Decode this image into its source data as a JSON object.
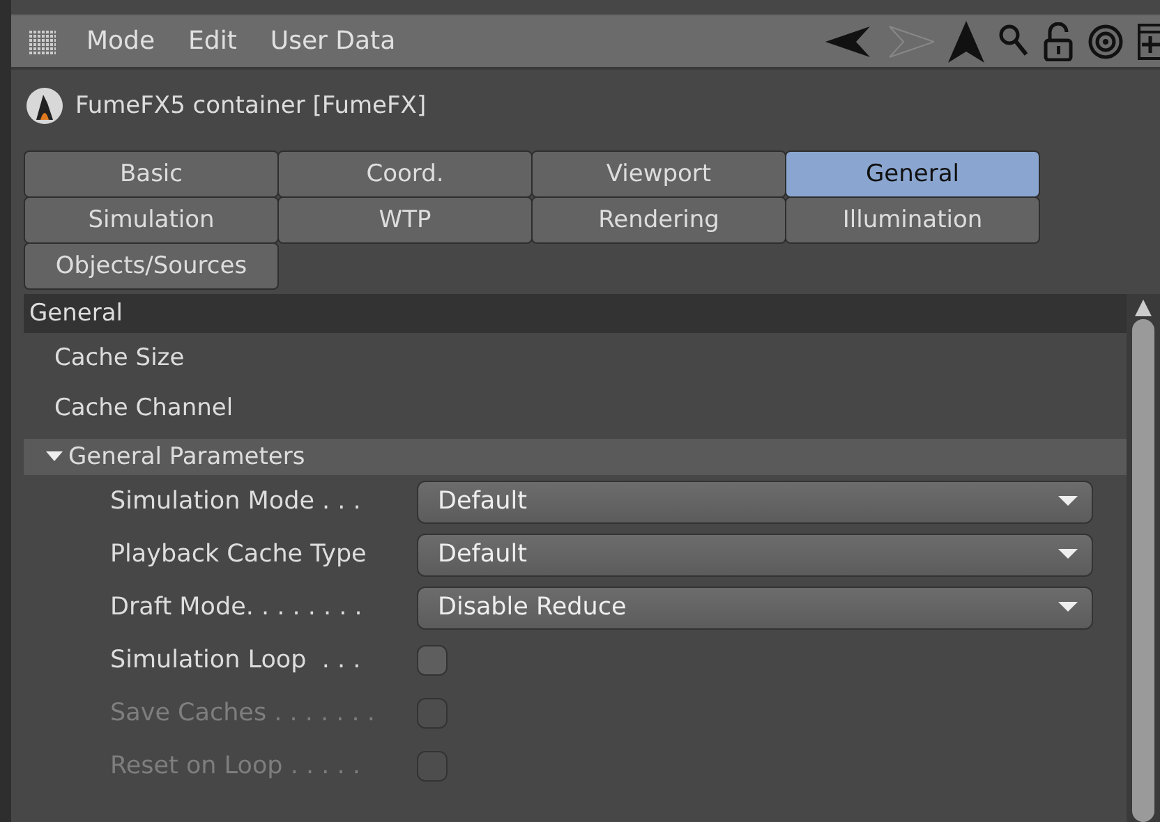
{
  "menu": [
    {
      "label": "Mode"
    },
    {
      "label": "Edit"
    },
    {
      "label": "User Data"
    }
  ],
  "object": {
    "title": "FumeFX5 container [FumeFX]"
  },
  "tabs": [
    {
      "label": "Basic",
      "selected": false
    },
    {
      "label": "Coord.",
      "selected": false
    },
    {
      "label": "Viewport",
      "selected": false
    },
    {
      "label": "General",
      "selected": true
    },
    {
      "label": "Simulation",
      "selected": false
    },
    {
      "label": "WTP",
      "selected": false
    },
    {
      "label": "Rendering",
      "selected": false
    },
    {
      "label": "Illumination",
      "selected": false
    },
    {
      "label": "Objects/Sources",
      "selected": false
    }
  ],
  "section": {
    "title": "General"
  },
  "info_rows": [
    {
      "label": "Cache Size"
    },
    {
      "label": "Cache Channel"
    }
  ],
  "group": {
    "title": "General Parameters",
    "expanded": true,
    "params": [
      {
        "kind": "dropdown",
        "label": "Simulation Mode . . .",
        "value": "Default",
        "disabled": false
      },
      {
        "kind": "dropdown",
        "label": "Playback Cache Type",
        "value": "Default",
        "disabled": false
      },
      {
        "kind": "dropdown",
        "label": "Draft Mode. . . . . . . .",
        "value": "Disable Reduce",
        "disabled": false
      },
      {
        "kind": "checkbox",
        "label": "Simulation Loop  . . .",
        "checked": false,
        "disabled": false
      },
      {
        "kind": "checkbox",
        "label": "Save Caches . . . . . . .",
        "checked": false,
        "disabled": true
      },
      {
        "kind": "checkbox",
        "label": "Reset on Loop . . . . .",
        "checked": false,
        "disabled": true
      }
    ]
  }
}
